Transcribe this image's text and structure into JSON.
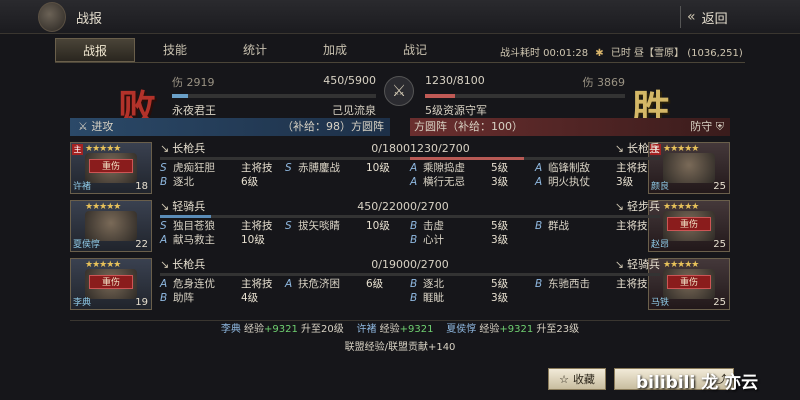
{
  "window": {
    "title": "战报",
    "back_label": "返回"
  },
  "tabs": [
    "战报",
    "技能",
    "统计",
    "加成",
    "战记"
  ],
  "battle_info": {
    "duration": "战斗耗时 00:01:28",
    "weather": "已时 昼【雪原】",
    "coords": "(1036,251)"
  },
  "result": {
    "left": "败",
    "right": "胜"
  },
  "left_summary": {
    "dmg_label": "伤",
    "dmg_value": "2919",
    "troops": "450/5900",
    "troop_fraction": 0.076,
    "player": "永夜君王",
    "status": "己见流泉"
  },
  "right_summary": {
    "troops": "1230/8100",
    "troop_fraction": 0.152,
    "dmg_label": "伤",
    "dmg_value": "3869",
    "name": "5级资源守军"
  },
  "left_panel": {
    "title": "进攻",
    "formation": "（补给：98）方圆阵"
  },
  "right_panel": {
    "formation": "方圆阵（补给：100）",
    "title": "防守"
  },
  "left_rows": [
    {
      "name": "许褚",
      "level": "18",
      "stars": "★★★★★",
      "badge": "重伤",
      "lord": "主",
      "unit": "长枪兵",
      "troops": "0/1800",
      "fraction": 0,
      "skills": [
        [
          "S",
          "虎痴狂胆",
          "主将技"
        ],
        [
          "S",
          "赤膊鏖战",
          "10级"
        ],
        [
          "B",
          "逐北",
          "6级"
        ]
      ]
    },
    {
      "name": "夏侯惇",
      "level": "22",
      "stars": "★★★★★",
      "badge": "",
      "lord": "",
      "unit": "轻骑兵",
      "troops": "450/2200",
      "fraction": 0.205,
      "skills": [
        [
          "S",
          "独目苍狼",
          "主将技"
        ],
        [
          "S",
          "拔矢啖睛",
          "10级"
        ],
        [
          "A",
          "献马救主",
          "10级"
        ]
      ]
    },
    {
      "name": "李典",
      "level": "19",
      "stars": "★★★★★",
      "badge": "重伤",
      "lord": "",
      "unit": "长枪兵",
      "troops": "0/1900",
      "fraction": 0,
      "skills": [
        [
          "A",
          "危身连优",
          "主将技"
        ],
        [
          "A",
          "扶危济困",
          "6级"
        ],
        [
          "B",
          "助阵",
          "4级"
        ]
      ]
    }
  ],
  "right_rows": [
    {
      "name": "颜良",
      "level": "25",
      "stars": "★★★★★",
      "badge": "",
      "lord": "主",
      "unit": "长枪兵",
      "troops": "1230/2700",
      "fraction": 0.456,
      "skills": [
        [
          "A",
          "乘隙捣虚",
          "5级"
        ],
        [
          "A",
          "临锋制敌",
          "主将技"
        ],
        [
          "A",
          "横行无忌",
          "3级"
        ],
        [
          "A",
          "明火执仗",
          "3级"
        ]
      ]
    },
    {
      "name": "赵昂",
      "level": "25",
      "stars": "★★★★★",
      "badge": "重伤",
      "lord": "",
      "unit": "轻步兵",
      "troops": "0/2700",
      "fraction": 0,
      "skills": [
        [
          "B",
          "击虚",
          "5级"
        ],
        [
          "B",
          "群战",
          "主将技"
        ],
        [
          "B",
          "心计",
          "3级"
        ]
      ]
    },
    {
      "name": "马铁",
      "level": "25",
      "stars": "★★★★★",
      "badge": "重伤",
      "lord": "",
      "unit": "轻骑兵",
      "troops": "0/2700",
      "fraction": 0,
      "skills": [
        [
          "B",
          "逐北",
          "5级"
        ],
        [
          "B",
          "东驰西击",
          "主将技"
        ],
        [
          "B",
          "睚眦",
          "3级"
        ]
      ]
    }
  ],
  "exp": {
    "e1_name": "李典",
    "e1_text": "经验",
    "e1_val": "+9321",
    "e1_up": "升至20级",
    "e2_name": "许褚",
    "e2_text": "经验",
    "e2_val": "+9321",
    "e3_name": "夏侯惇",
    "e3_text": "经验",
    "e3_val": "+9321",
    "e3_up": "升至23级",
    "alliance_text": "联盟经验/联盟贡献",
    "alliance_val": "+140"
  },
  "buttons": {
    "collect": "收藏",
    "collect_icon": "star-icon"
  },
  "watermark": "bilibili 龙 亦云",
  "colors": {
    "lose": "#b2322a",
    "win": "#d4b867",
    "attack": "#2b4968",
    "defense": "#6a2e2e"
  }
}
